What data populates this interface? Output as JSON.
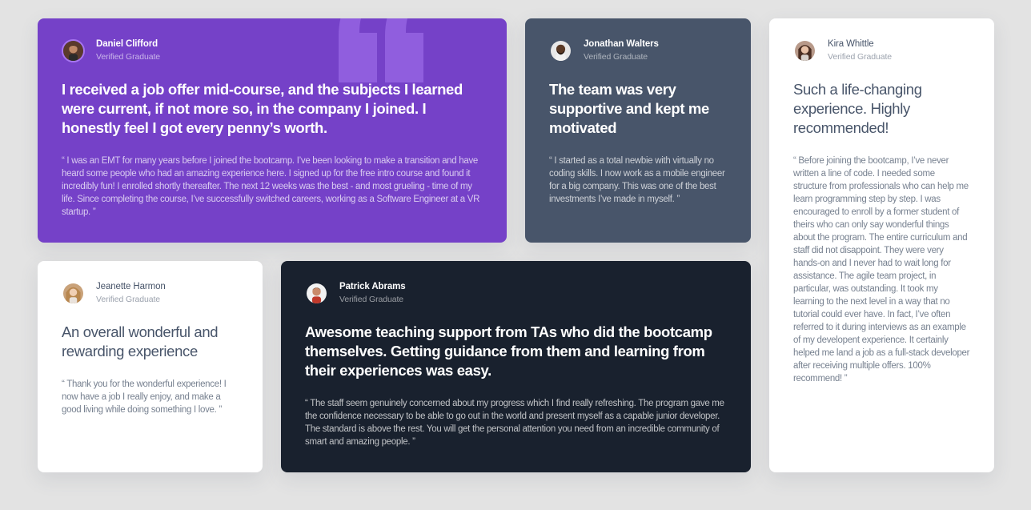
{
  "colors": {
    "background": "#e3e3e3",
    "purple": "#7541c8",
    "slate": "#48556a",
    "dark": "#19212e",
    "white": "#ffffff",
    "avatar_border": "#a775f1"
  },
  "testimonials": [
    {
      "name": "Daniel Clifford",
      "status": "Verified Graduate",
      "headline": "I received a job offer mid-course, and the subjects I learned were current, if not more so, in the company I joined. I honestly feel I got every penny’s worth.",
      "quote": "“ I was an EMT for many years before I joined the bootcamp. I’ve been looking to make a transition and have heard some people who had an amazing experience here. I signed up for the free intro course and found it incredibly fun! I enrolled shortly thereafter. The next 12 weeks was the best - and most grueling - time of my life. Since completing the course, I’ve successfully switched careers, working as a Software Engineer at a VR startup. ”",
      "avatar_icon": "avatar-daniel-icon"
    },
    {
      "name": "Jonathan Walters",
      "status": "Verified Graduate",
      "headline": "The team was very supportive and kept me motivated",
      "quote": "“ I started as a total newbie with virtually no coding skills. I now work as a mobile engineer for a big company. This was one of the best investments I’ve made in myself. ”",
      "avatar_icon": "avatar-jonathan-icon"
    },
    {
      "name": "Kira Whittle",
      "status": "Verified Graduate",
      "headline": "Such a life-changing experience. Highly recommended!",
      "quote": "“ Before joining the bootcamp, I’ve never written a line of code. I needed some structure from professionals who can help me learn programming step by step. I was encouraged to enroll by a former student of theirs who can only say wonderful things about the program. The entire curriculum and staff did not disappoint. They were very hands-on and I never had to wait long for assistance. The agile team project, in particular, was outstanding. It took my learning to the next level in a way that no tutorial could ever have. In fact, I’ve often referred to it during interviews as an example of my developent experience. It certainly helped me land a job as a full-stack developer after receiving multiple offers. 100% recommend! ”",
      "avatar_icon": "avatar-kira-icon"
    },
    {
      "name": "Jeanette Harmon",
      "status": "Verified Graduate",
      "headline": "An overall wonderful and rewarding experience",
      "quote": "“ Thank you for the wonderful experience! I now have a job I really enjoy, and make a good living while doing something I love. ”",
      "avatar_icon": "avatar-jeanette-icon"
    },
    {
      "name": "Patrick Abrams",
      "status": "Verified Graduate",
      "headline": "Awesome teaching support from TAs who did the bootcamp themselves. Getting guidance from them and learning from their experiences was easy.",
      "quote": "“ The staff seem genuinely concerned about my progress which I find really refreshing. The program gave me the confidence necessary to be able to go out in the world and present myself as a capable junior developer. The standard is above the rest. You will get the personal attention you need from an incredible community of smart and amazing people. ”",
      "avatar_icon": "avatar-patrick-icon"
    }
  ]
}
